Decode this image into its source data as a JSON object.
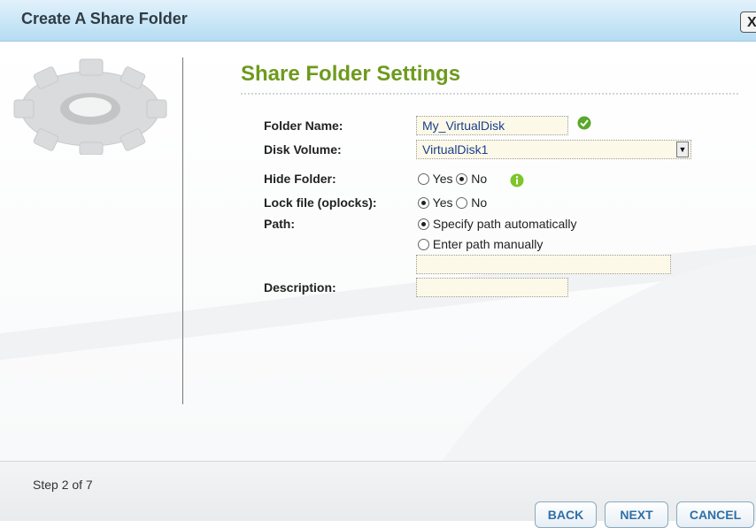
{
  "window": {
    "title": "Create A Share Folder",
    "close_label": "X"
  },
  "main": {
    "heading": "Share Folder Settings",
    "fields": {
      "folder_name": {
        "label": "Folder Name:",
        "value": "My_VirtualDisk"
      },
      "disk_volume": {
        "label": "Disk Volume:",
        "value": "VirtualDisk1"
      },
      "hide_folder": {
        "label": "Hide Folder:",
        "options": [
          "Yes",
          "No"
        ],
        "selected": "No"
      },
      "lock_file": {
        "label": "Lock file (oplocks):",
        "options": [
          "Yes",
          "No"
        ],
        "selected": "Yes"
      },
      "path": {
        "label": "Path:",
        "options": [
          "Specify path automatically",
          "Enter path manually"
        ],
        "selected": "Specify path automatically",
        "manual_value": ""
      },
      "description": {
        "label": "Description:",
        "value": ""
      }
    }
  },
  "footer": {
    "step": "Step 2 of 7",
    "back_label": "BACK",
    "next_label": "NEXT",
    "cancel_label": "CANCEL"
  },
  "colors": {
    "heading": "#6e9a1e",
    "title_bar": "#c9e6f7",
    "button_text": "#2f6fa8",
    "field_bg": "#fdf9e9"
  }
}
